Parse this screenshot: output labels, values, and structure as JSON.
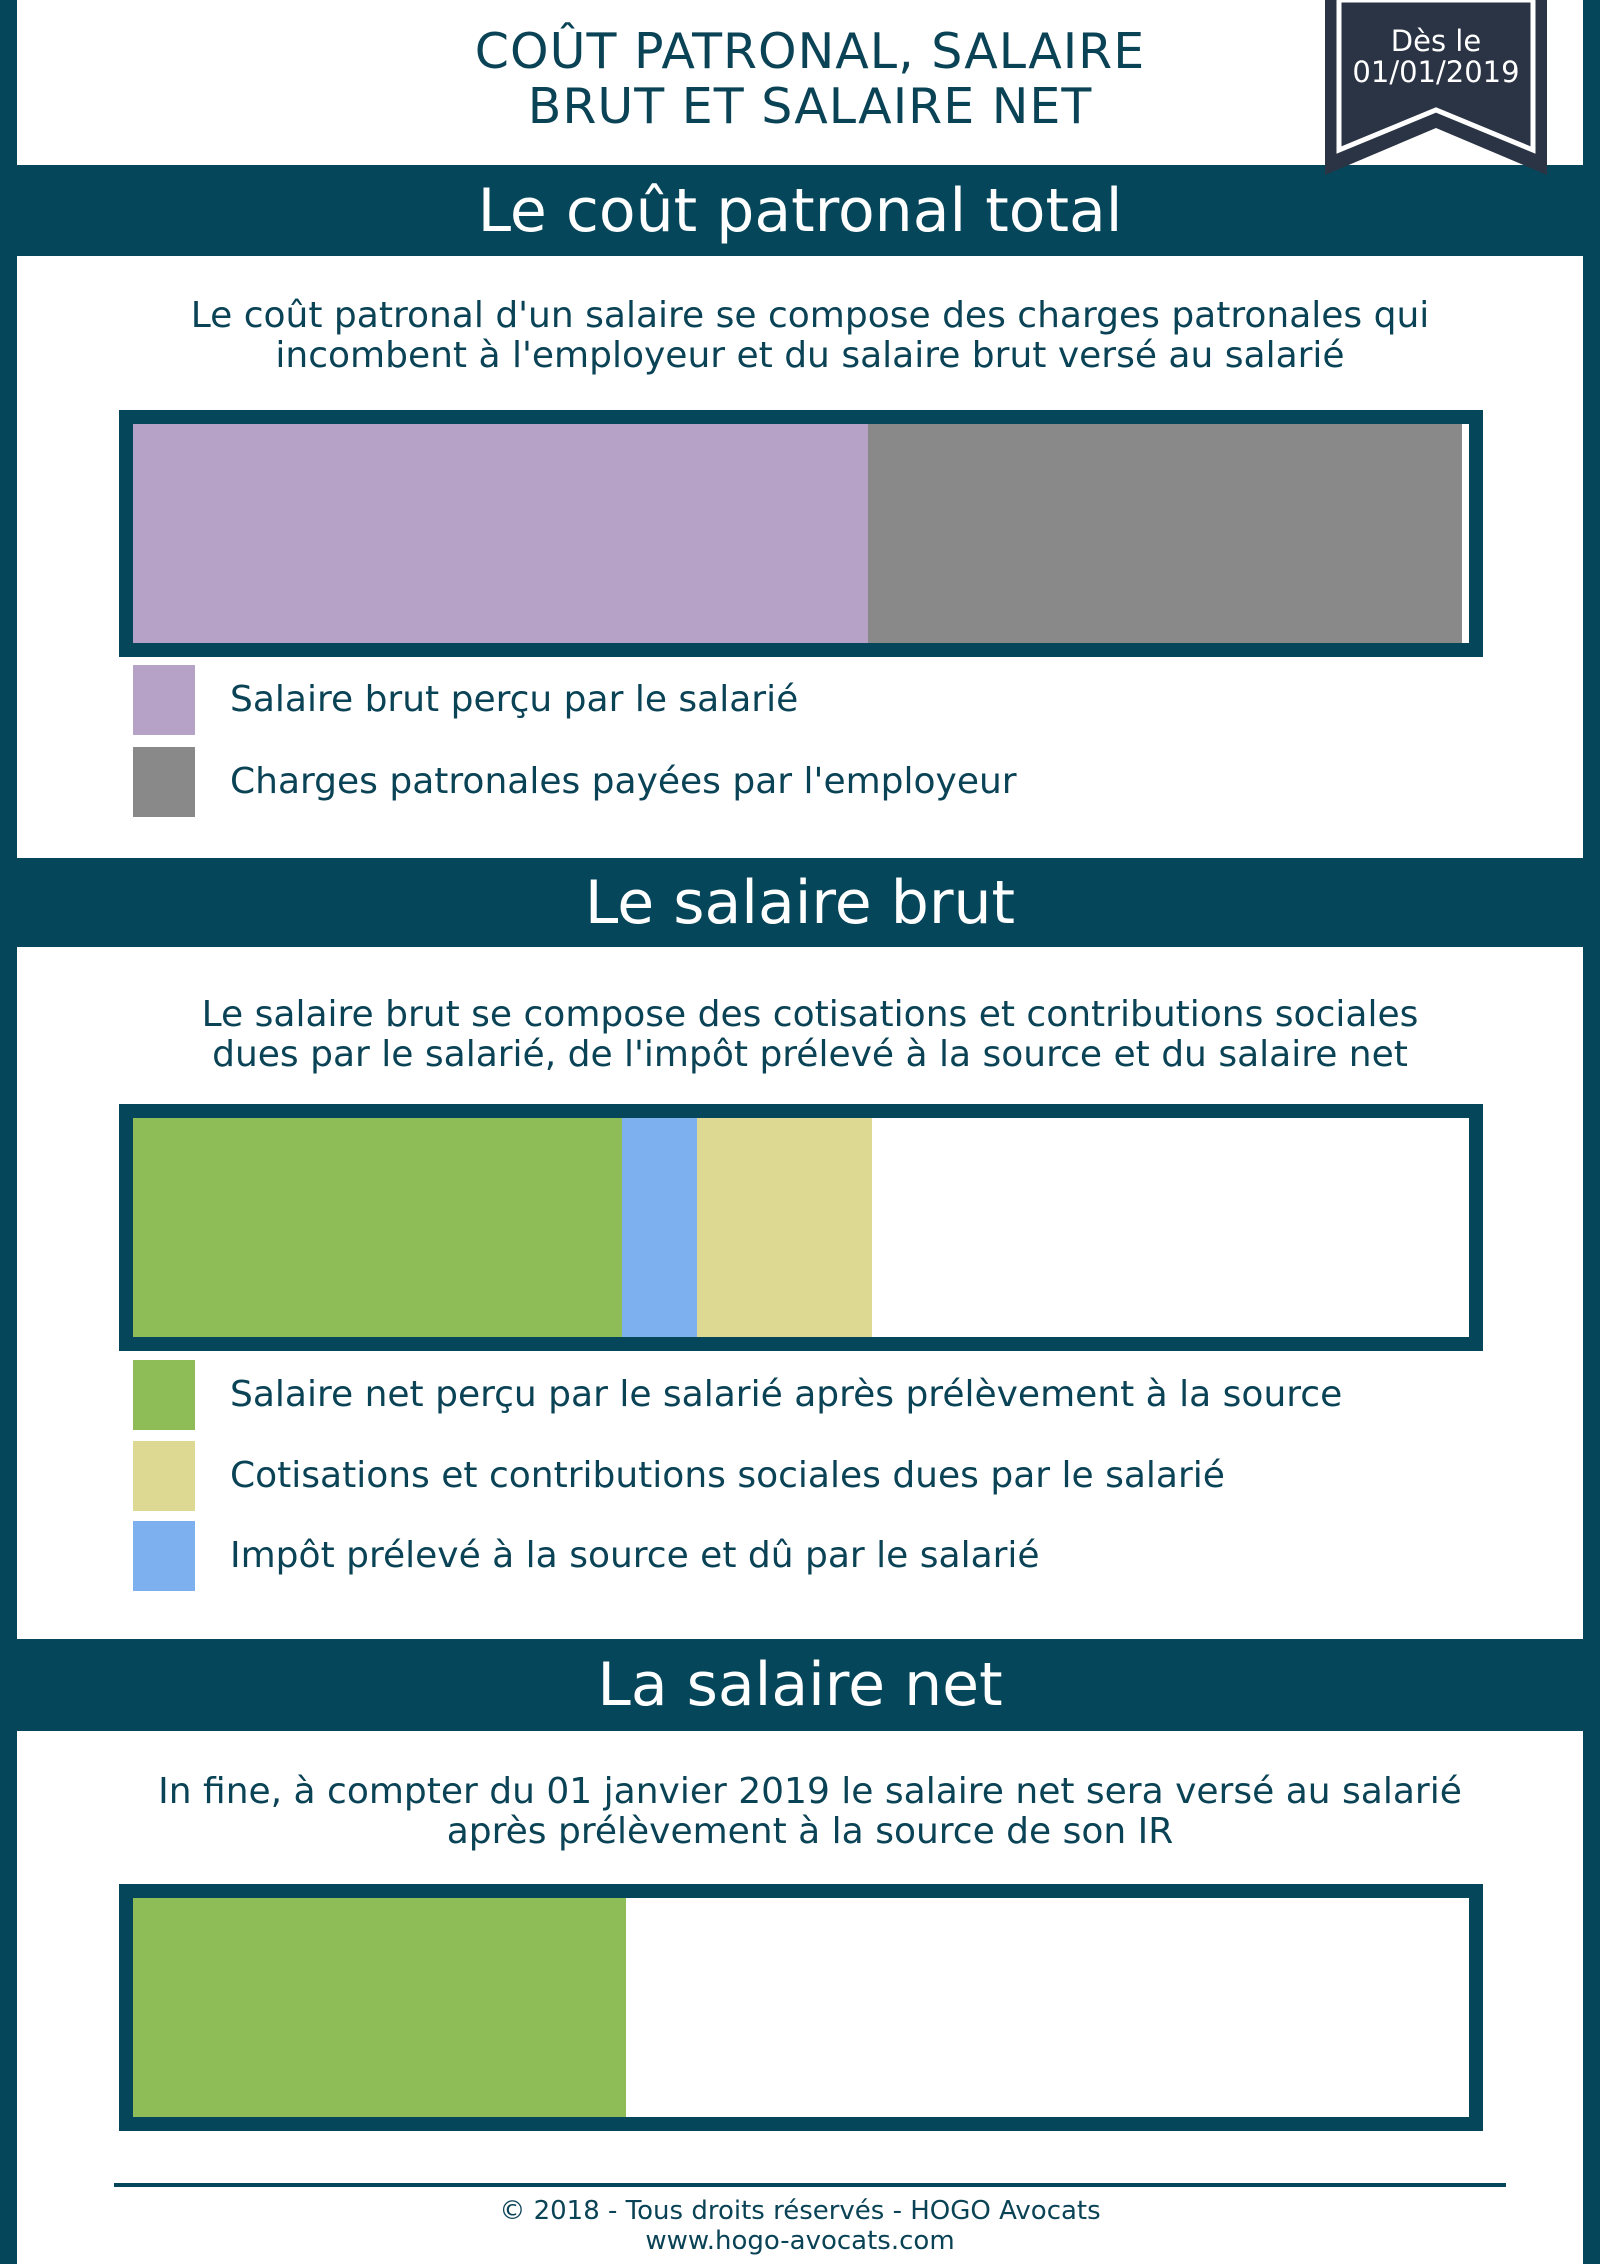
{
  "header": {
    "title_line1": "COÛT PATRONAL, SALAIRE",
    "title_line2": "BRUT ET SALAIRE NET",
    "ribbon_line1": "Dès le",
    "ribbon_line2": "01/01/2019"
  },
  "colors": {
    "frame": "#06465a",
    "text": "#0b4356",
    "salaire_brut": "#b6a2c6",
    "charges_patronales": "#898989",
    "salaire_net": "#8ebd58",
    "impot": "#7db0ee",
    "cotisations": "#ddd993"
  },
  "sections": [
    {
      "heading": "Le coût patronal total",
      "description_lines": [
        "Le coût patronal d'un salaire se compose des charges patronales qui",
        "incombent à l'employeur et du salaire brut versé au salarié"
      ],
      "bar": [
        {
          "key": "salaire_brut",
          "percent": 55
        },
        {
          "key": "charges_patronales",
          "percent": 44.5
        }
      ],
      "legend": [
        {
          "key": "salaire_brut",
          "label": "Salaire brut perçu par le salarié"
        },
        {
          "key": "charges_patronales",
          "label": "Charges patronales payées par l'employeur"
        }
      ]
    },
    {
      "heading": "Le salaire brut",
      "description_lines": [
        "Le salaire brut se compose des cotisations et contributions sociales",
        "dues par le salarié, de l'impôt prélevé à la source et du salaire net"
      ],
      "bar": [
        {
          "key": "salaire_net",
          "percent": 36.6
        },
        {
          "key": "impot",
          "percent": 5.6
        },
        {
          "key": "cotisations",
          "percent": 13.1
        }
      ],
      "legend": [
        {
          "key": "salaire_net",
          "label": "Salaire net perçu par le salarié après prélèvement à la source"
        },
        {
          "key": "cotisations",
          "label": "Cotisations et contributions sociales dues par le salarié"
        },
        {
          "key": "impot",
          "label": "Impôt prélevé à la source et dû par le salarié"
        }
      ]
    },
    {
      "heading": "La salaire net",
      "description_lines": [
        "In fine, à compter du 01 janvier 2019 le salaire net sera versé au salarié",
        "après prélèvement à la source de son IR"
      ],
      "bar": [
        {
          "key": "salaire_net",
          "percent": 36.9
        }
      ],
      "legend": []
    }
  ],
  "footer": {
    "line1": "© 2018 - Tous droits réservés - HOGO Avocats",
    "line2": "www.hogo-avocats.com"
  }
}
